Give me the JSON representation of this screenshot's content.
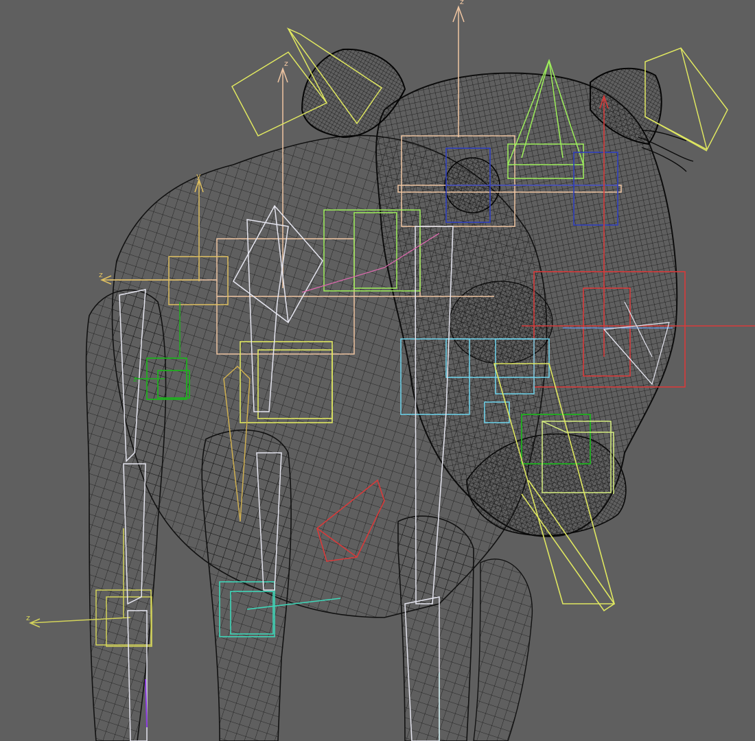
{
  "viewport": {
    "background": "#5f5f5f",
    "mesh_color": "#111111"
  },
  "axis_labels": {
    "z": "z",
    "y": "y"
  },
  "colors": {
    "bone_white": "#e6e6f0",
    "helper_yellow": "#e0e860",
    "helper_green": "#9ef05a",
    "helper_cyan": "#6fd6ef",
    "helper_blue": "#2f3fbf",
    "helper_red": "#d83a3a",
    "helper_peach": "#f0c6a2",
    "helper_darkgreen": "#1fb01f",
    "helper_lime": "#d8f080",
    "helper_teal": "#3fd6b8"
  }
}
